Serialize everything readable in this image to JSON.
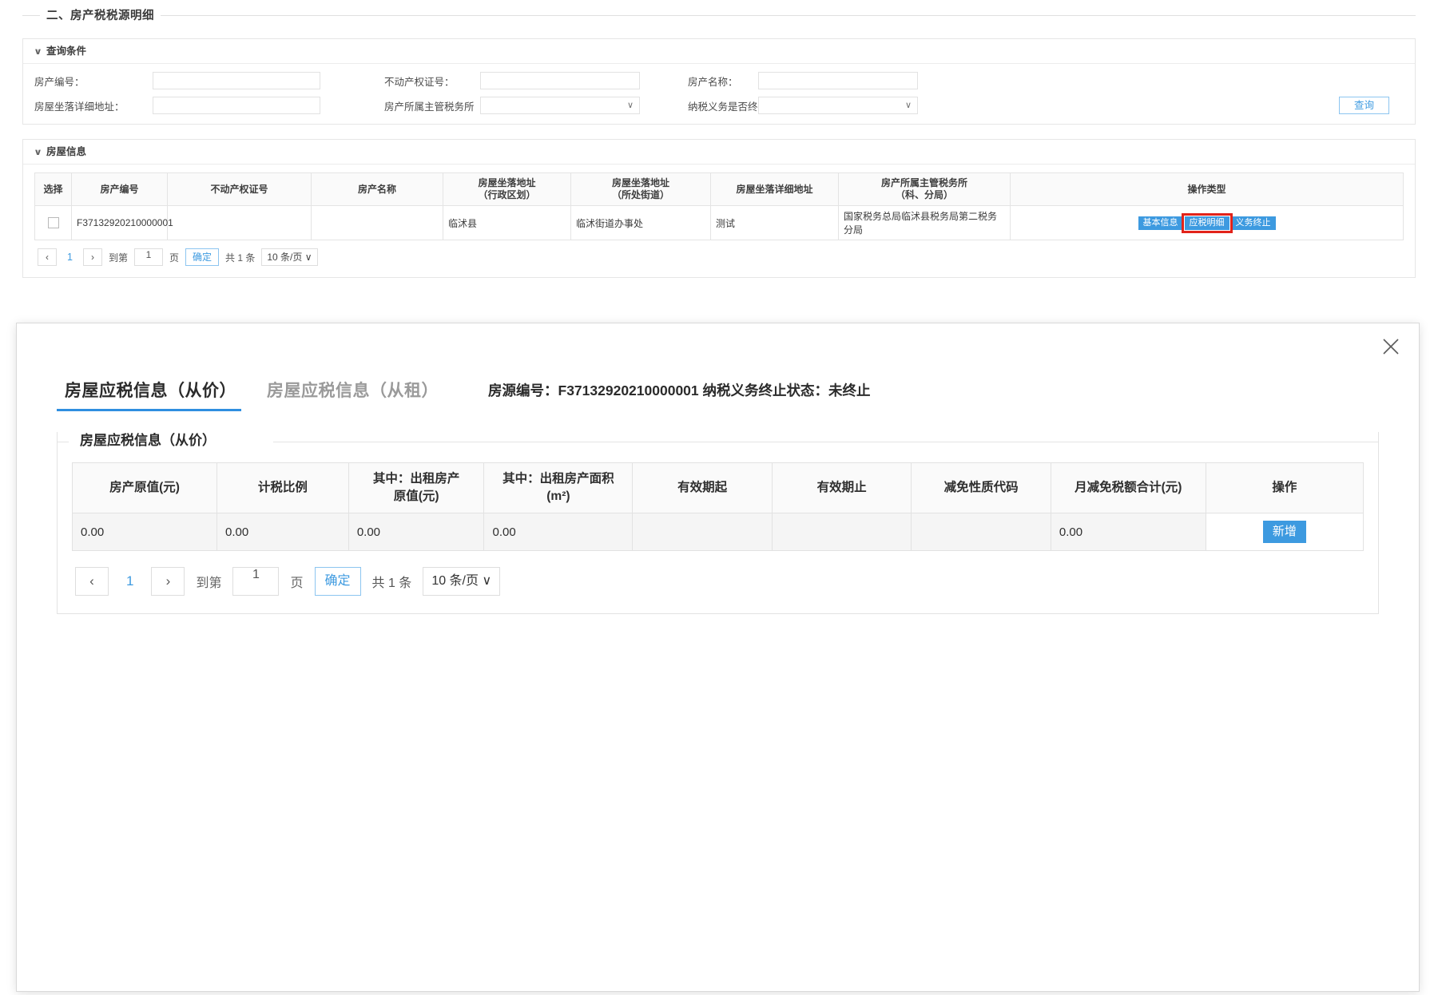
{
  "section": {
    "title": "二、房产税税源明细"
  },
  "query_panel": {
    "header": "查询条件",
    "caret": "chevron-down",
    "fields": [
      {
        "label": "房产编号：",
        "value": "",
        "type": "text"
      },
      {
        "label": "不动产权证号：",
        "value": "",
        "type": "text"
      },
      {
        "label": "房产名称：",
        "value": "",
        "type": "text"
      },
      {
        "label": "房屋坐落详细地址：",
        "value": "",
        "type": "text"
      },
      {
        "label": "房产所属主管税务所（科、分局）：",
        "value": "",
        "type": "select"
      },
      {
        "label": "纳税义务是否终止：",
        "value": "",
        "type": "select"
      }
    ],
    "query_button": "查询"
  },
  "house_panel": {
    "header": "房屋信息",
    "columns": [
      "选择",
      "房产编号",
      "不动产权证号",
      "房产名称",
      "房屋坐落地址\n（行政区划）",
      "房屋坐落地址\n（所处街道）",
      "房屋坐落详细地址",
      "房产所属主管税务所\n（科、分局）",
      "操作类型"
    ],
    "columns_display": {
      "select": "选择",
      "property_no": "房产编号",
      "cert_no": "不动产权证号",
      "property_name": "房产名称",
      "addr_district_l1": "房屋坐落地址",
      "addr_district_l2": "（行政区划）",
      "addr_street_l1": "房屋坐落地址",
      "addr_street_l2": "（所处街道）",
      "addr_detail": "房屋坐落详细地址",
      "tax_office_l1": "房产所属主管税务所",
      "tax_office_l2": "（科、分局）",
      "op_type": "操作类型"
    },
    "rows": [
      {
        "property_no": "F37132920210000001",
        "cert_no": "",
        "property_name": "",
        "addr_district": "临沭县",
        "addr_street": "临沭街道办事处",
        "addr_detail": "测试",
        "tax_office": "国家税务总局临沭县税务局第二税务分局",
        "actions": [
          {
            "label": "基本信息",
            "selected": false
          },
          {
            "label": "应税明细",
            "selected": true
          },
          {
            "label": "义务终止",
            "selected": false
          }
        ]
      }
    ],
    "pager": {
      "prev": "‹",
      "page": "1",
      "next": "›",
      "goto_prefix": "到第",
      "goto_value": "1",
      "goto_suffix": "页",
      "confirm": "确定",
      "total": "共 1 条",
      "page_size": "10 条/页"
    }
  },
  "modal": {
    "close_icon": "close-icon",
    "tabs": [
      {
        "label": "房屋应税信息（从价）",
        "active": true
      },
      {
        "label": "房屋应税信息（从租）",
        "active": false
      }
    ],
    "meta": "房源编号：F37132920210000001  纳税义务终止状态：未终止",
    "fieldset_title": "房屋应税信息（从价）",
    "table": {
      "columns": {
        "original_value": "房产原值(元)",
        "tax_ratio": "计税比例",
        "rent_value_l1": "其中：出租房产",
        "rent_value_l2": "原值(元)",
        "rent_area_l1": "其中：出租房产面积",
        "rent_area_l2": "(m²)",
        "valid_from": "有效期起",
        "valid_to": "有效期止",
        "reduction_code": "减免性质代码",
        "monthly_reduction": "月减免税额合计(元)",
        "operation": "操作"
      },
      "rows": [
        {
          "original_value": "0.00",
          "tax_ratio": "0.00",
          "rent_value": "0.00",
          "rent_area": "0.00",
          "valid_from": "",
          "valid_to": "",
          "reduction_code": "",
          "monthly_reduction": "0.00",
          "operation": "新增"
        }
      ]
    },
    "pager": {
      "prev": "‹",
      "page": "1",
      "next": "›",
      "goto_prefix": "到第",
      "goto_value": "1",
      "goto_suffix": "页",
      "confirm": "确定",
      "total": "共 1 条",
      "page_size": "10 条/页"
    }
  },
  "colors": {
    "accent": "#3d9ae0",
    "highlight": "#e2231a",
    "border": "#e4e4e4",
    "header_bg": "#fafafa"
  }
}
